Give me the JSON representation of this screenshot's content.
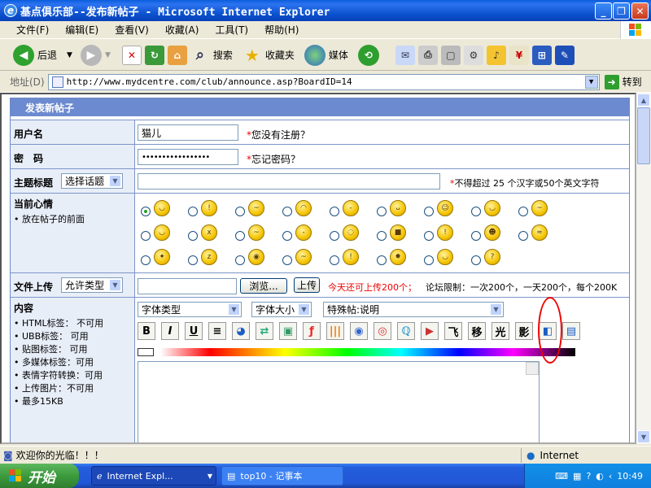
{
  "window": {
    "title": "基点俱乐部--发布新帖子 - Microsoft Internet Explorer"
  },
  "menu": [
    "文件(F)",
    "编辑(E)",
    "查看(V)",
    "收藏(A)",
    "工具(T)",
    "帮助(H)"
  ],
  "toolbar": {
    "back": "后退",
    "search": "搜索",
    "favorites": "收藏夹",
    "media": "媒体"
  },
  "address": {
    "label": "地址(D)",
    "url": "http://www.mydcentre.com/club/announce.asp?BoardID=14",
    "go": "转到"
  },
  "form": {
    "header": "发表新帖子",
    "username_label": "用户名",
    "username_value": "猫儿",
    "register_link": "您没有注册？",
    "password_label": "密　码",
    "password_value": "•••••••••••••••••",
    "forgot_link": "忘记密码？",
    "subject_label": "主题标题",
    "subject_select": "选择话题",
    "subject_hint": "不得超过 25 个汉字或50个英文字符",
    "mood_label": "当前心情",
    "mood_hint": "放在帖子的前面",
    "upload_label": "文件上传",
    "upload_select": "允许类型",
    "browse": "浏览...",
    "upload_btn": "上传",
    "upload_today": "今天还可上传200个；",
    "upload_limit": "论坛限制：一次200个，一天200个，每个200K",
    "content_label": "内容",
    "content_rules": [
      "HTML标签： 不可用",
      "UBB标签： 可用",
      "贴图标签： 可用",
      "多媒体标签：可用",
      "表情字符转换：可用",
      "上传图片：不可用",
      "最多15KB"
    ],
    "font_type": "字体类型",
    "font_size": "字体大小",
    "special": "特殊帖:说明",
    "editor_buttons": [
      "B",
      "I",
      "U",
      "≡",
      "飞",
      "移",
      "光",
      "影"
    ]
  },
  "status": {
    "text": "欢迎你的光临！！！",
    "zone": "Internet"
  },
  "taskbar": {
    "start": "开始",
    "task1": "Internet Expl...",
    "task2": "top10 - 记事本",
    "time": "10:49"
  }
}
